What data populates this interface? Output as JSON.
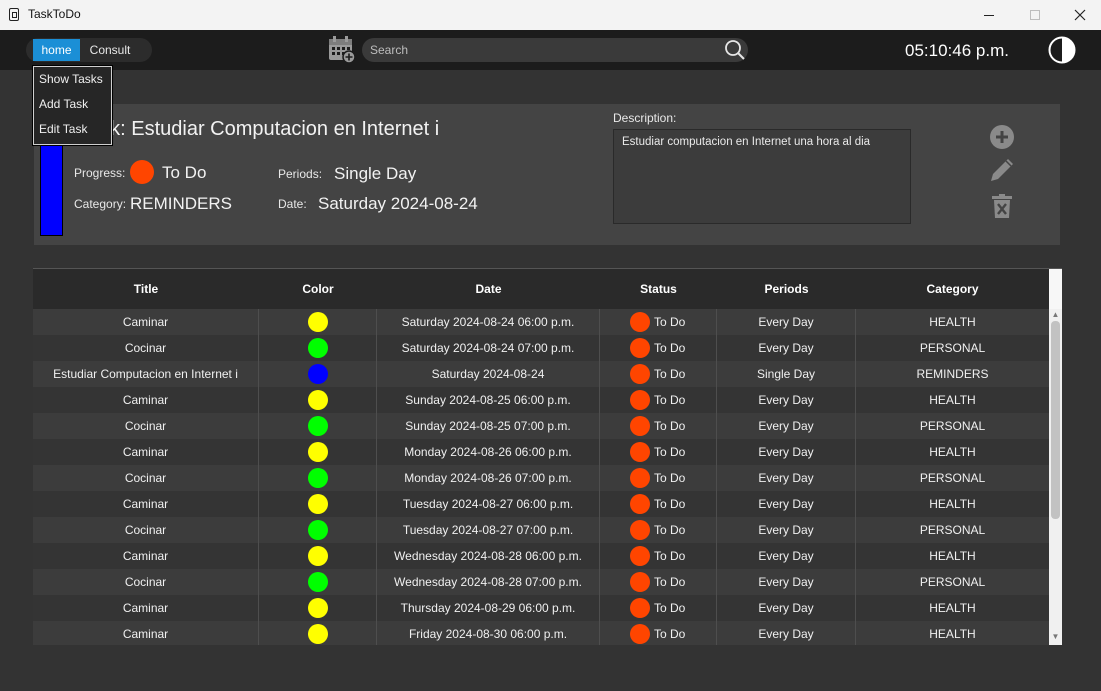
{
  "window": {
    "title": "TaskToDo"
  },
  "nav": {
    "home_label": "home",
    "consult_label": "Consult",
    "search_placeholder": "Search",
    "clock": "05:10:46 p.m.",
    "menu": [
      "Show Tasks",
      "Add Task",
      "Edit Task"
    ]
  },
  "detail": {
    "task_prefix": "Task:",
    "title": "Estudiar Computacion en Internet i",
    "progress_label": "Progress:",
    "progress_value": "To Do",
    "category_label": "Category:",
    "category_value": "REMINDERS",
    "periods_label": "Periods:",
    "periods_value": "Single Day",
    "date_label": "Date:",
    "date_value": "Saturday 2024-08-24",
    "description_label": "Description:",
    "description_value": "Estudiar computacion en Internet una hora al dia",
    "strip_color": "#0000ff",
    "progress_color": "#ff4500"
  },
  "table": {
    "headers": [
      "Title",
      "Color",
      "Date",
      "Status",
      "Periods",
      "Category"
    ],
    "rows": [
      {
        "title": "Caminar",
        "color": "#ffff00",
        "date": "Saturday 2024-08-24  06:00 p.m.",
        "status": "To Do",
        "periods": "Every Day",
        "category": "HEALTH"
      },
      {
        "title": "Cocinar",
        "color": "#00ff00",
        "date": "Saturday 2024-08-24  07:00 p.m.",
        "status": "To Do",
        "periods": "Every Day",
        "category": "PERSONAL"
      },
      {
        "title": "Estudiar Computacion en Internet i",
        "color": "#0000ff",
        "date": "Saturday 2024-08-24",
        "status": "To Do",
        "periods": "Single Day",
        "category": "REMINDERS"
      },
      {
        "title": "Caminar",
        "color": "#ffff00",
        "date": "Sunday 2024-08-25  06:00 p.m.",
        "status": "To Do",
        "periods": "Every Day",
        "category": "HEALTH"
      },
      {
        "title": "Cocinar",
        "color": "#00ff00",
        "date": "Sunday 2024-08-25  07:00 p.m.",
        "status": "To Do",
        "periods": "Every Day",
        "category": "PERSONAL"
      },
      {
        "title": "Caminar",
        "color": "#ffff00",
        "date": "Monday 2024-08-26  06:00 p.m.",
        "status": "To Do",
        "periods": "Every Day",
        "category": "HEALTH"
      },
      {
        "title": "Cocinar",
        "color": "#00ff00",
        "date": "Monday 2024-08-26  07:00 p.m.",
        "status": "To Do",
        "periods": "Every Day",
        "category": "PERSONAL"
      },
      {
        "title": "Caminar",
        "color": "#ffff00",
        "date": "Tuesday 2024-08-27  06:00 p.m.",
        "status": "To Do",
        "periods": "Every Day",
        "category": "HEALTH"
      },
      {
        "title": "Cocinar",
        "color": "#00ff00",
        "date": "Tuesday 2024-08-27  07:00 p.m.",
        "status": "To Do",
        "periods": "Every Day",
        "category": "PERSONAL"
      },
      {
        "title": "Caminar",
        "color": "#ffff00",
        "date": "Wednesday 2024-08-28  06:00 p.m.",
        "status": "To Do",
        "periods": "Every Day",
        "category": "HEALTH"
      },
      {
        "title": "Cocinar",
        "color": "#00ff00",
        "date": "Wednesday 2024-08-28  07:00 p.m.",
        "status": "To Do",
        "periods": "Every Day",
        "category": "PERSONAL"
      },
      {
        "title": "Caminar",
        "color": "#ffff00",
        "date": "Thursday 2024-08-29  06:00 p.m.",
        "status": "To Do",
        "periods": "Every Day",
        "category": "HEALTH"
      },
      {
        "title": "Caminar",
        "color": "#ffff00",
        "date": "Friday 2024-08-30  06:00 p.m.",
        "status": "To Do",
        "periods": "Every Day",
        "category": "HEALTH"
      }
    ]
  },
  "icons": {
    "calendar": "calendar-add-icon",
    "search": "search-icon",
    "theme": "theme-toggle-icon",
    "add": "add-circle-icon",
    "edit": "pencil-icon",
    "delete": "trash-icon"
  }
}
